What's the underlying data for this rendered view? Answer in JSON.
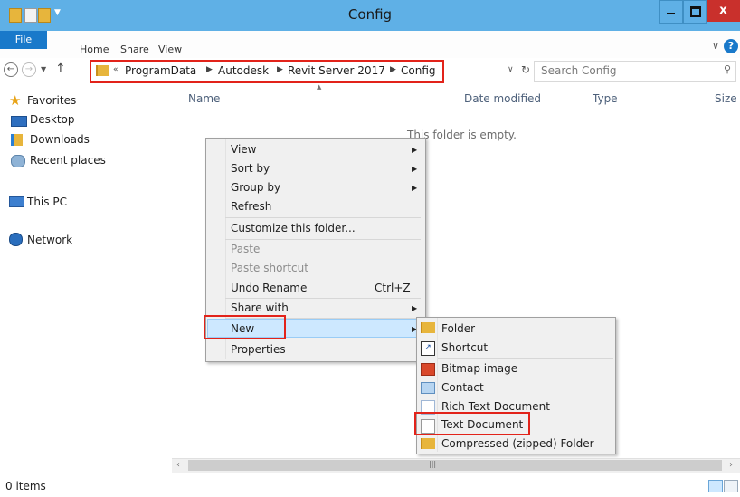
{
  "window": {
    "title": "Config"
  },
  "ribbon": {
    "tabs": [
      "File",
      "Home",
      "Share",
      "View"
    ]
  },
  "address": {
    "path": [
      "ProgramData",
      "Autodesk",
      "Revit Server 2017",
      "Config"
    ],
    "search_placeholder": "Search Config"
  },
  "columns": {
    "name": "Name",
    "date_modified": "Date modified",
    "type": "Type",
    "size": "Size"
  },
  "nav": {
    "favorites": "Favorites",
    "desktop": "Desktop",
    "downloads": "Downloads",
    "recent": "Recent places",
    "this_pc": "This PC",
    "network": "Network"
  },
  "content": {
    "empty_message": "This folder is empty."
  },
  "context_menu": {
    "view": "View",
    "sort_by": "Sort by",
    "group_by": "Group by",
    "refresh": "Refresh",
    "customize": "Customize this folder...",
    "paste": "Paste",
    "paste_shortcut": "Paste shortcut",
    "undo_rename": "Undo Rename",
    "undo_shortcut": "Ctrl+Z",
    "share_with": "Share with",
    "new": "New",
    "properties": "Properties"
  },
  "new_submenu": {
    "folder": "Folder",
    "shortcut": "Shortcut",
    "bitmap": "Bitmap image",
    "contact": "Contact",
    "rich_text": "Rich Text Document",
    "text_doc": "Text Document",
    "zipped": "Compressed (zipped) Folder"
  },
  "status": {
    "items": "0 items"
  },
  "colors": {
    "titlebar": "#5fb0e6",
    "file_tab": "#1979ca",
    "close": "#c9302c",
    "highlight": "#e2231a",
    "menu_hover": "#cde8ff"
  }
}
